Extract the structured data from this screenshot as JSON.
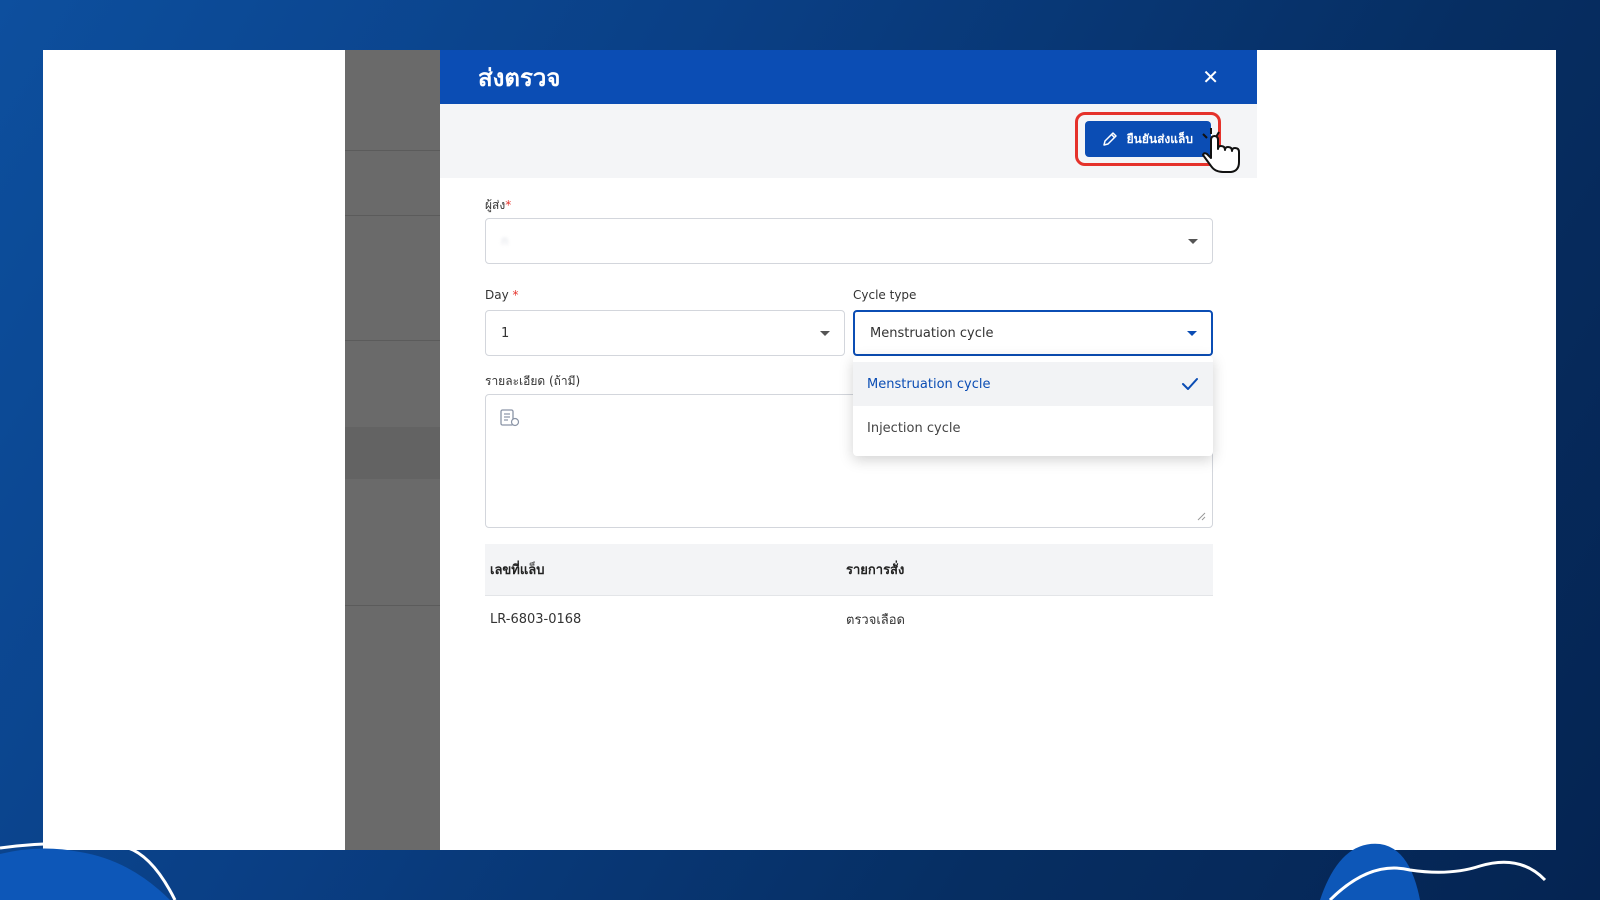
{
  "modal": {
    "title": "ส่งตรวจ",
    "close_icon": "close-icon"
  },
  "toolbar": {
    "confirm_label": "ยืนยันส่งแล็บ",
    "confirm_icon": "pencil-icon",
    "highlight_color": "#e5322b"
  },
  "form": {
    "sender": {
      "label": "ผู้ส่ง",
      "required_mark": "*",
      "value": "ก"
    },
    "day": {
      "label": "Day",
      "required_mark": "*",
      "value": "1"
    },
    "cycle_type": {
      "label": "Cycle type",
      "value": "Menstruation cycle",
      "options": [
        {
          "label": "Menstruation cycle",
          "selected": true
        },
        {
          "label": "Injection cycle",
          "selected": false
        }
      ]
    },
    "details": {
      "label": "รายละเอียด (ถ้ามี)"
    }
  },
  "table": {
    "headers": [
      "เลขที่แล็บ",
      "รายการสั่ง"
    ],
    "rows": [
      [
        "LR-6803-0168",
        "ตรวจเลือด"
      ]
    ]
  },
  "colors": {
    "primary": "#0b4db4",
    "background_gradient": [
      "#0d4f9e",
      "#052452"
    ]
  }
}
